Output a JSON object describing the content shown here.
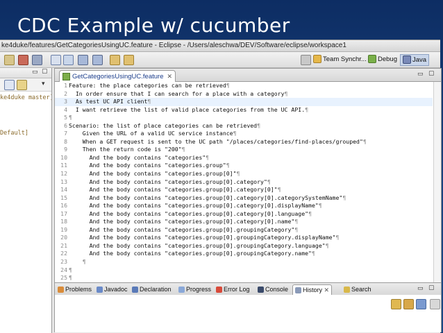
{
  "slide": {
    "title": "CDC Example w/ cucumber"
  },
  "window": {
    "title": "ke4duke/features/GetCategoriesUsingUC.feature - Eclipse - /Users/aleschwa/DEV/Software/eclipse/workspace1"
  },
  "perspectives": [
    {
      "label": "Team Synchr...",
      "icon": "team-sync-icon",
      "active": false
    },
    {
      "label": "Debug",
      "icon": "debug-icon",
      "active": false
    },
    {
      "label": "Java",
      "icon": "java-icon",
      "active": true
    }
  ],
  "left_panel": {
    "lines": [
      "ke4duke master]",
      "Default]"
    ]
  },
  "editor": {
    "tab_label": "GetCategoriesUsingUC.feature",
    "lines": [
      {
        "n": "1",
        "text": "Feature: the place categories can be retrieved"
      },
      {
        "n": "2",
        "text": "  In order ensure that I can search for a place with a category"
      },
      {
        "n": "3",
        "text": "  As test UC API client"
      },
      {
        "n": "4",
        "text": "  I want retrieve the list of valid place categories from the UC API."
      },
      {
        "n": "5",
        "text": ""
      },
      {
        "n": "6",
        "text": "Scenario: the list of place categories can be retrieved"
      },
      {
        "n": "7",
        "text": "    Given the URL of a valid UC service instance"
      },
      {
        "n": "8",
        "text": "    When a GET request is sent to the UC path \"/places/categories/find-places/grouped\""
      },
      {
        "n": "9",
        "text": "    Then the return code is \"200\""
      },
      {
        "n": "10",
        "text": "      And the body contains \"categories\""
      },
      {
        "n": "11",
        "text": "      And the body contains \"categories.group\""
      },
      {
        "n": "12",
        "text": "      And the body contains \"categories.group[0]\""
      },
      {
        "n": "13",
        "text": "      And the body contains \"categories.group[0].category\""
      },
      {
        "n": "14",
        "text": "      And the body contains \"categories.group[0].category[0]\""
      },
      {
        "n": "15",
        "text": "      And the body contains \"categories.group[0].category[0].categorySystemName\""
      },
      {
        "n": "16",
        "text": "      And the body contains \"categories.group[0].category[0].displayName\""
      },
      {
        "n": "17",
        "text": "      And the body contains \"categories.group[0].category[0].language\""
      },
      {
        "n": "18",
        "text": "      And the body contains \"categories.group[0].category[0].name\""
      },
      {
        "n": "19",
        "text": "      And the body contains \"categories.group[0].groupingCategory\""
      },
      {
        "n": "20",
        "text": "      And the body contains \"categories.group[0].groupingCategory.displayName\""
      },
      {
        "n": "21",
        "text": "      And the body contains \"categories.group[0].groupingCategory.language\""
      },
      {
        "n": "22",
        "text": "      And the body contains \"categories.group[0].groupingCategory.name\""
      },
      {
        "n": "23",
        "text": "    "
      },
      {
        "n": "24",
        "text": ""
      },
      {
        "n": "25",
        "text": ""
      }
    ],
    "highlighted_line": 3
  },
  "bottom_tabs": [
    {
      "label": "Problems",
      "icon": "problems-icon",
      "active": false
    },
    {
      "label": "Javadoc",
      "icon": "javadoc-icon",
      "active": false
    },
    {
      "label": "Declaration",
      "icon": "declaration-icon",
      "active": false
    },
    {
      "label": "Progress",
      "icon": "progress-icon",
      "active": false
    },
    {
      "label": "Error Log",
      "icon": "error-log-icon",
      "active": false
    },
    {
      "label": "Console",
      "icon": "console-icon",
      "active": false
    },
    {
      "label": "History",
      "icon": "history-icon",
      "active": true
    },
    {
      "label": "Search",
      "icon": "search-icon",
      "active": false
    }
  ],
  "colors": {
    "slide_background": "#1b4480",
    "editor_tab_text": "#1a3c8a",
    "line_highlight": "#e8f2fe",
    "whitespace_marker": "#9a9a9a"
  }
}
